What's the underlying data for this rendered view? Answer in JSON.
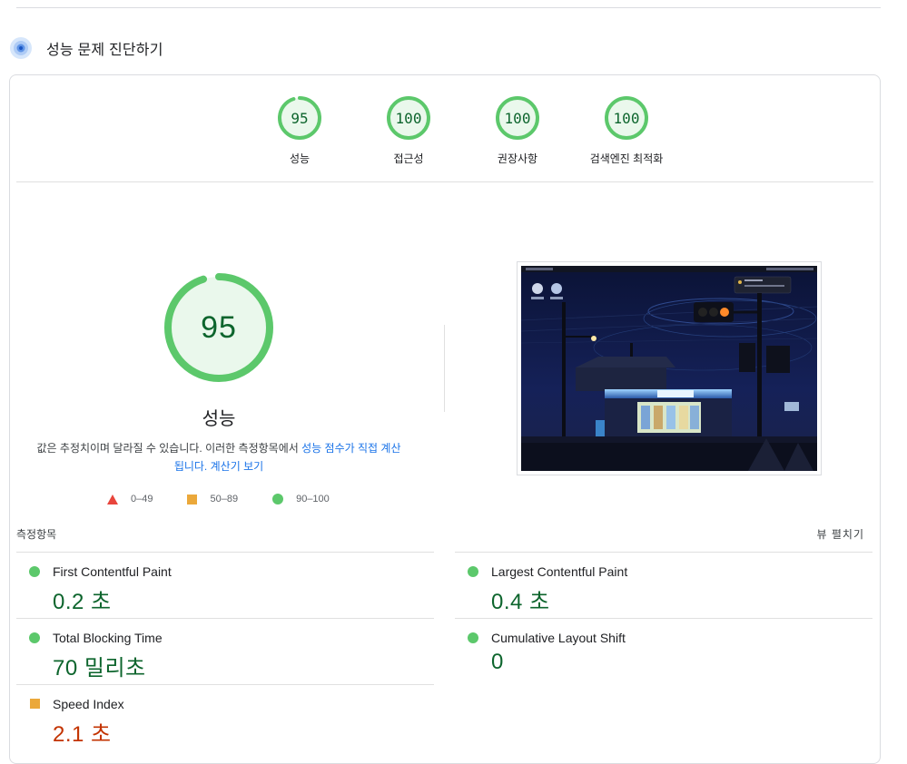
{
  "section": {
    "title": "성능 문제 진단하기",
    "icon": "diagnostics-icon"
  },
  "summary": [
    {
      "score": "95",
      "label": "성능",
      "percent": 95
    },
    {
      "score": "100",
      "label": "접근성",
      "percent": 100
    },
    {
      "score": "100",
      "label": "권장사항",
      "percent": 100
    },
    {
      "score": "100",
      "label": "검색엔진 최적화",
      "percent": 100
    }
  ],
  "performance": {
    "score": "95",
    "percent": 95,
    "title": "성능",
    "desc_text": "값은 추정치이며 달라질 수 있습니다. 이러한 측정항목에서 ",
    "desc_link": "성능 점수가 직접 계산됩니다.",
    "desc_space": " ",
    "desc_calc_link": "계산기 보기"
  },
  "legend": [
    {
      "icon": "triangle-fail-icon",
      "range": "0–49"
    },
    {
      "icon": "square-average-icon",
      "range": "50–89"
    },
    {
      "icon": "circle-pass-icon",
      "range": "90–100"
    }
  ],
  "metrics_header": {
    "title": "측정항목",
    "expand": "뷰 펼치기"
  },
  "metrics": {
    "fcp": {
      "name": "First Contentful Paint",
      "value": "0.2 초",
      "status": "pass"
    },
    "lcp": {
      "name": "Largest Contentful Paint",
      "value": "0.4 초",
      "status": "pass"
    },
    "tbt": {
      "name": "Total Blocking Time",
      "value": "70 밀리초",
      "status": "pass"
    },
    "cls": {
      "name": "Cumulative Layout Shift",
      "value": "0",
      "status": "pass"
    },
    "si": {
      "name": "Speed Index",
      "value": "2.1 초",
      "status": "average"
    }
  },
  "colors": {
    "pass": "#0d652d",
    "pass_ring": "#5cc86b",
    "pass_fill": "#eaf8ec",
    "average": "#c33300",
    "fail": "#e8453c",
    "link": "#1a73e8"
  }
}
